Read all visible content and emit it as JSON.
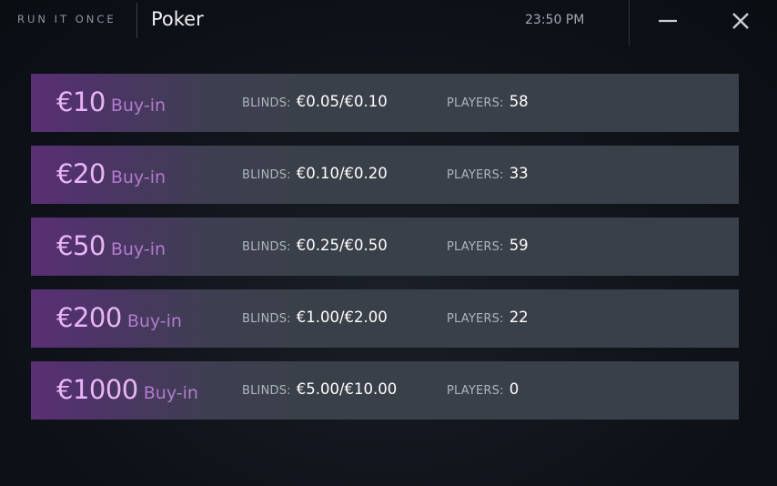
{
  "titlebar": {
    "brand": "RUN IT ONCE",
    "title": "Poker",
    "clock": "23:50 PM",
    "minimize_icon": "minimize-icon",
    "close_icon": "close-icon"
  },
  "colors": {
    "row_accent": "#5a2f74",
    "row_base": "#3a4049",
    "amount_text": "#e9b6f4",
    "buyin_text": "#b17ccc"
  },
  "labels": {
    "blinds": "BLINDS:",
    "players": "PLAYERS:"
  },
  "tables": [
    {
      "amount": "€10",
      "buyin": "Buy-in",
      "blinds": "€0.05/€0.10",
      "players": "58"
    },
    {
      "amount": "€20",
      "buyin": "Buy-in",
      "blinds": "€0.10/€0.20",
      "players": "33"
    },
    {
      "amount": "€50",
      "buyin": "Buy-in",
      "blinds": "€0.25/€0.50",
      "players": "59"
    },
    {
      "amount": "€200",
      "buyin": "Buy-in",
      "blinds": "€1.00/€2.00",
      "players": "22"
    },
    {
      "amount": "€1000",
      "buyin": "Buy-in",
      "blinds": "€5.00/€10.00",
      "players": "0"
    }
  ]
}
